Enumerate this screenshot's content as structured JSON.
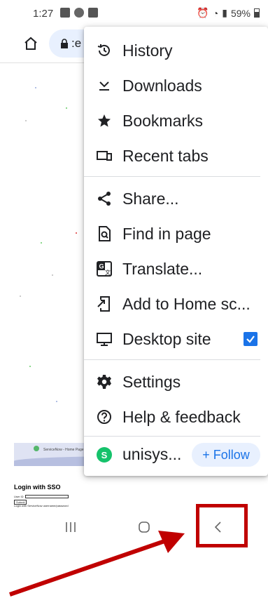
{
  "status_bar": {
    "time": "1:27",
    "battery": "59%"
  },
  "toolbar": {
    "url_fragment": ":e",
    "home_icon": "home-icon",
    "lock_icon": "lock-icon"
  },
  "page": {
    "banner_text": "ServiceNow - Home Page",
    "login_title": "Login with SSO",
    "user_id_label": "User ID",
    "submit_label": "Submit",
    "footer_text": "Login with ServiceNow username/password"
  },
  "menu": {
    "items": [
      {
        "label": "History",
        "icon": "history-icon"
      },
      {
        "label": "Downloads",
        "icon": "downloads-icon"
      },
      {
        "label": "Bookmarks",
        "icon": "bookmarks-star-icon"
      },
      {
        "label": "Recent tabs",
        "icon": "recent-tabs-icon"
      },
      {
        "label": "Share...",
        "icon": "share-icon"
      },
      {
        "label": "Find in page",
        "icon": "find-in-page-icon"
      },
      {
        "label": "Translate...",
        "icon": "translate-icon"
      },
      {
        "label": "Add to Home sc...",
        "icon": "add-to-home-icon"
      },
      {
        "label": "Desktop site",
        "icon": "desktop-icon",
        "checked": true
      },
      {
        "label": "Settings",
        "icon": "gear-icon"
      },
      {
        "label": "Help & feedback",
        "icon": "help-icon"
      }
    ],
    "follow_site": {
      "avatar_letter": "S",
      "name": "unisys...",
      "follow_label": "+ Follow"
    }
  },
  "nav": {
    "recents_icon": "recents-icon",
    "home_icon": "home-circle-icon",
    "back_icon": "back-chevron-icon"
  },
  "colors": {
    "accent": "#1a73e8",
    "url_pill": "#e8f0fe",
    "site_avatar": "#15c26b",
    "annotation_red": "#c00000"
  }
}
